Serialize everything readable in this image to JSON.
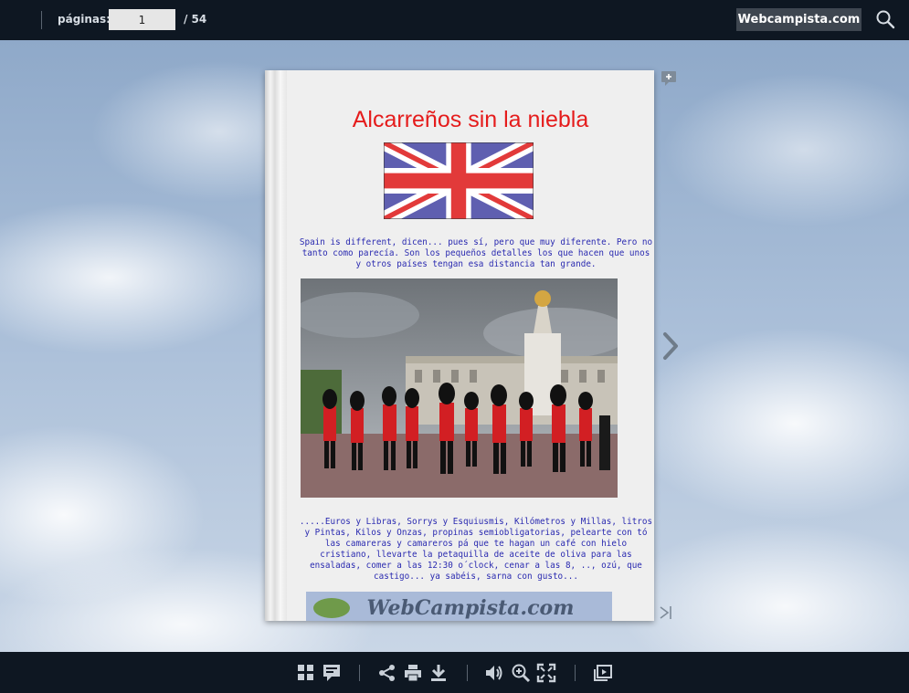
{
  "topbar": {
    "pages_label": "páginas:",
    "page_current": "1",
    "page_total": "/ 54",
    "site_button": "Webcampista.com",
    "search_icon": "search-icon"
  },
  "page": {
    "title": "Alcarreños sin la niebla",
    "flag_image": "union-jack-flag",
    "paragraph1": "Spain is different, dicen... pues sí, pero que muy diferente. Pero no tanto como parecía. Son los pequeños detalles los que hacen que unos y otros países tengan esa distancia tan grande.",
    "photo": "buckingham-palace-guards-photo",
    "paragraph2": ".....Euros y Libras, Sorrys y Esquiusmis, Kilómetros y Millas, litros y Pintas, Kilos y Onzas, propinas semiobligatorias, pelearte con tó las camareras y camareros pá que te hagan un café con hielo cristiano, llevarte la petaquilla de aceite de oliva para las ensaladas, comer a las 12:30 o´clock, cenar a las 8, .., ozú, que castigo... ya sabéis, sarna con gusto...",
    "banner_text": "WebCampista.com"
  },
  "navigation": {
    "next_icon": "chevron-right-icon",
    "last_icon": "last-page-icon",
    "comment_icon": "add-comment-icon"
  },
  "toolbar": {
    "icons": [
      "grid-icon",
      "comments-icon",
      "share-icon",
      "print-icon",
      "download-icon",
      "volume-icon",
      "zoom-in-icon",
      "fullscreen-icon",
      "slideshow-icon"
    ]
  },
  "colors": {
    "bar_bg": "#0e1722",
    "title_red": "#e51c1c",
    "text_blue": "#2a2ab0"
  }
}
